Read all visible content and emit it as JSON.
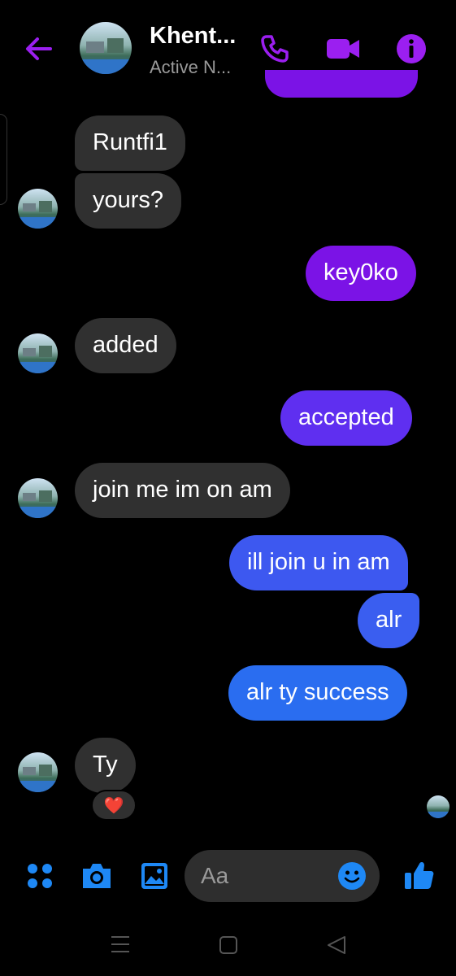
{
  "header": {
    "contact_name": "Khent...",
    "status": "Active N..."
  },
  "messages": [
    {
      "text": "Runtfi1",
      "direction": "incoming"
    },
    {
      "text": "yours?",
      "direction": "incoming"
    },
    {
      "text": "key0ko",
      "direction": "outgoing"
    },
    {
      "text": "added",
      "direction": "incoming"
    },
    {
      "text": "accepted",
      "direction": "outgoing"
    },
    {
      "text": "join me im on am",
      "direction": "incoming"
    },
    {
      "text": "ill join u in am",
      "direction": "outgoing"
    },
    {
      "text": "alr",
      "direction": "outgoing"
    },
    {
      "text": "alr ty success",
      "direction": "outgoing"
    },
    {
      "text": "Ty",
      "direction": "incoming",
      "reaction": "❤️"
    }
  ],
  "composer": {
    "placeholder": "Aa"
  },
  "colors": {
    "accent": "#9b1ff0",
    "incoming_bubble": "#303030",
    "outgoing_gradient": [
      "#7b13e6",
      "#2a6df0"
    ],
    "composer_icons": "#1e88f5"
  },
  "icons": [
    "back-arrow-icon",
    "phone-icon",
    "video-camera-icon",
    "info-icon",
    "apps-grid-icon",
    "camera-icon",
    "image-icon",
    "emoji-icon",
    "thumbs-up-icon",
    "menu-icon",
    "home-square-icon",
    "back-triangle-icon"
  ]
}
